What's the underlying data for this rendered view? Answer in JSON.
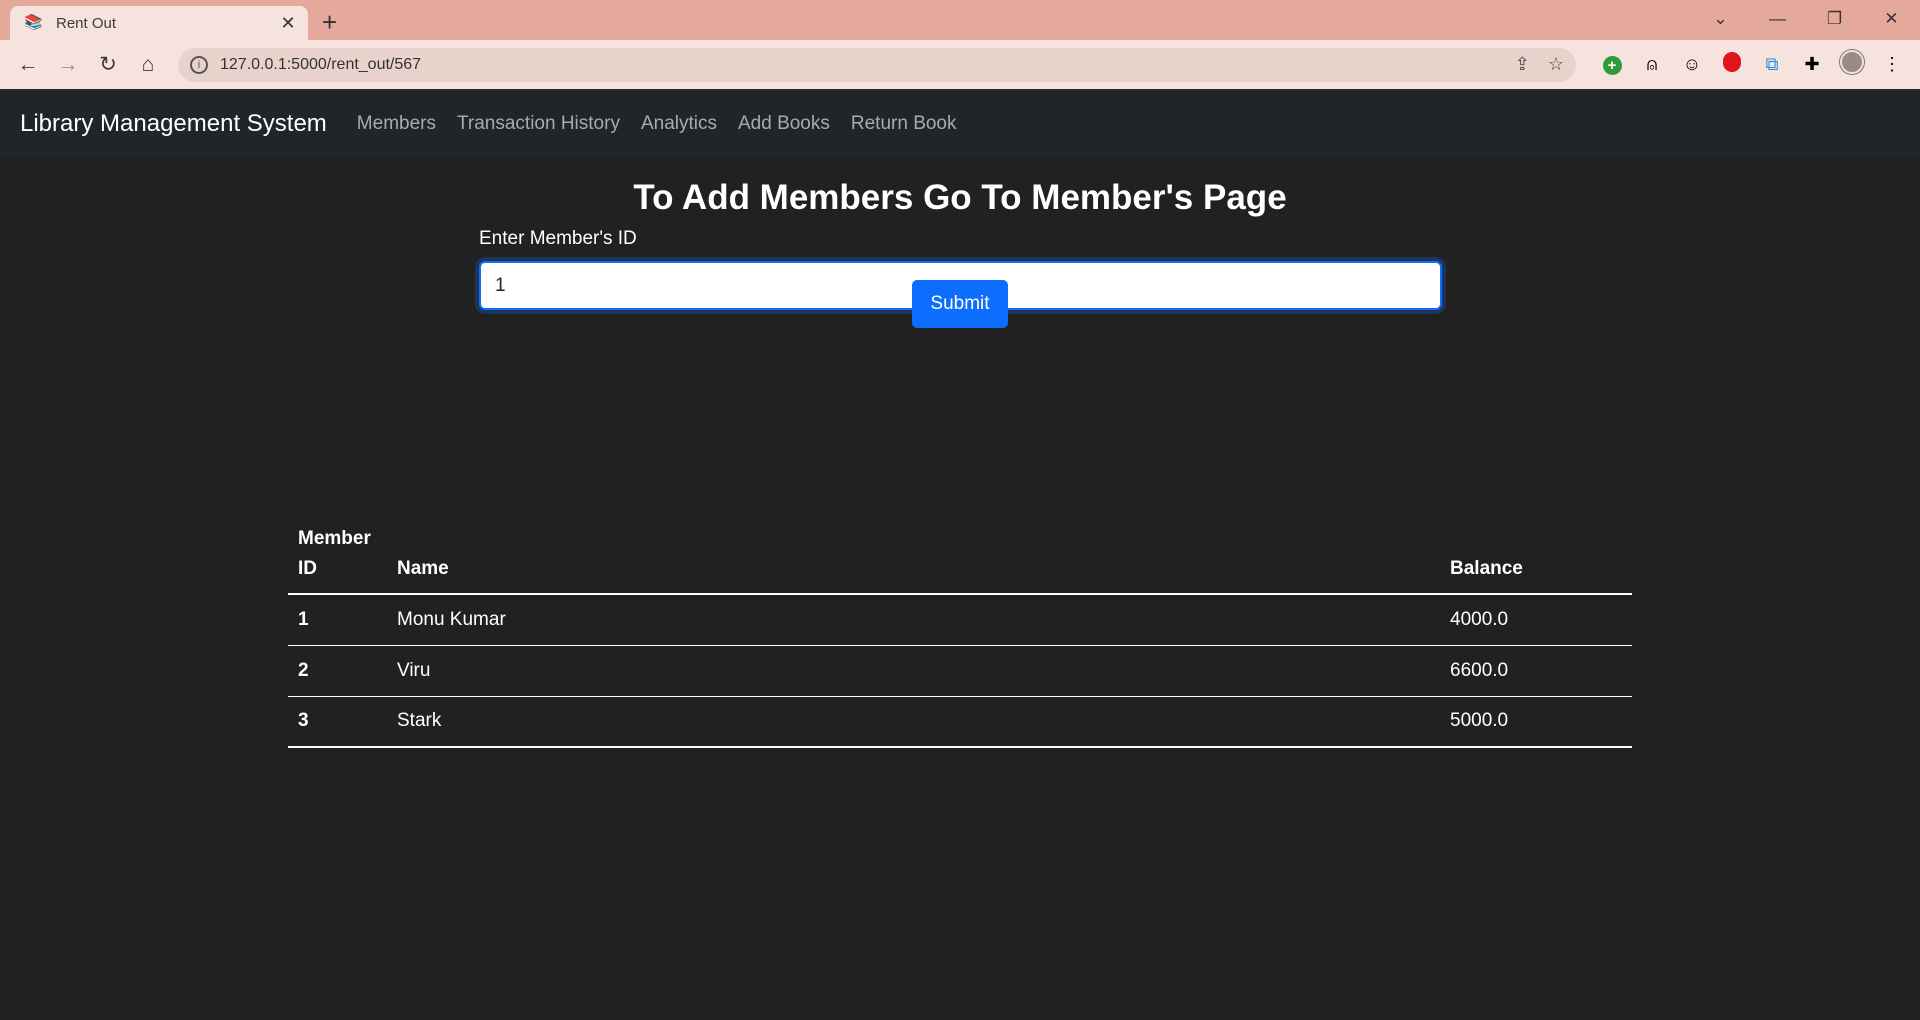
{
  "browser": {
    "tab_title": "Rent Out",
    "url": "127.0.0.1:5000/rent_out/567"
  },
  "navbar": {
    "brand": "Library Management System",
    "links": [
      "Members",
      "Transaction History",
      "Analytics",
      "Add Books",
      "Return Book"
    ]
  },
  "main": {
    "heading": "To Add Members Go To Member's Page",
    "member_id_label": "Enter Member's ID",
    "member_id_value": "1",
    "submit_label": "Submit"
  },
  "table": {
    "headers": {
      "id_line1": "Member",
      "id_line2": "ID",
      "name": "Name",
      "balance": "Balance"
    },
    "rows": [
      {
        "id": "1",
        "name": "Monu Kumar",
        "balance": "4000.0"
      },
      {
        "id": "2",
        "name": "Viru",
        "balance": "6600.0"
      },
      {
        "id": "3",
        "name": "Stark",
        "balance": "5000.0"
      }
    ]
  },
  "colors": {
    "primary": "#0d6efd",
    "page_bg": "#212121",
    "navbar_bg": "#212529",
    "browser_frame": "#e4a99b"
  }
}
